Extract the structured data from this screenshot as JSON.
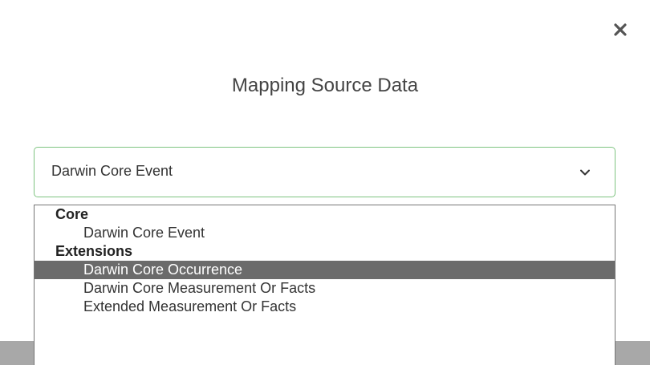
{
  "dialog": {
    "title": "Mapping Source Data",
    "close_icon": "close-icon"
  },
  "select": {
    "value": "Darwin Core Event",
    "chevron_icon": "chevron-down-icon",
    "border_color": "#7fc481"
  },
  "dropdown": {
    "groups": [
      {
        "label": "Core",
        "options": [
          "Darwin Core Event"
        ]
      },
      {
        "label": "Extensions",
        "options": [
          "Darwin Core Occurrence",
          "Darwin Core Measurement Or Facts",
          "Extended Measurement Or Facts"
        ]
      }
    ],
    "highlighted": "Darwin Core Occurrence",
    "highlight_color": "#6b6b6b"
  }
}
